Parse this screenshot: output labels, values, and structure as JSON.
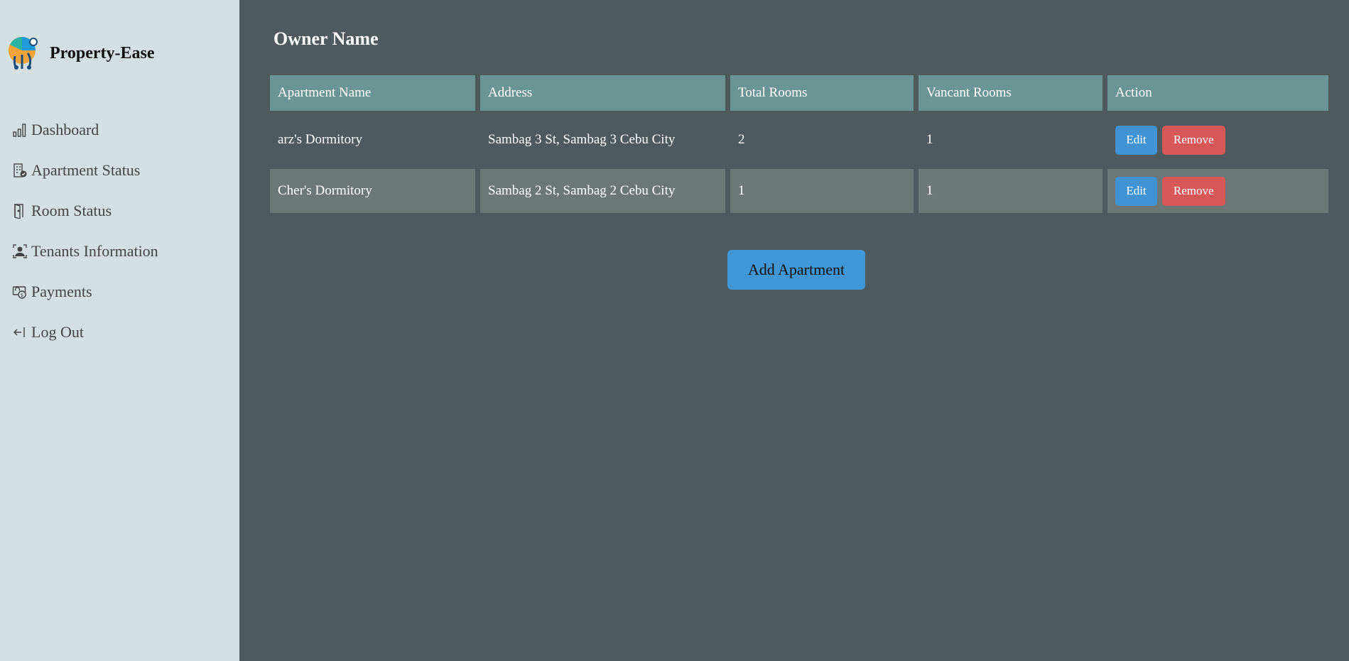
{
  "brand": {
    "name": "Property-Ease",
    "logo_icon": "property-ease-logo-icon"
  },
  "sidebar": {
    "items": [
      {
        "label": "Dashboard",
        "icon": "bar-chart-icon"
      },
      {
        "label": "Apartment Status",
        "icon": "building-check-icon"
      },
      {
        "label": "Room Status",
        "icon": "door-icon"
      },
      {
        "label": "Tenants Information",
        "icon": "person-badge-icon"
      },
      {
        "label": "Payments",
        "icon": "cash-icon"
      },
      {
        "label": "Log Out",
        "icon": "logout-arrow-icon"
      }
    ]
  },
  "main": {
    "owner_name": "Owner Name",
    "table": {
      "headers": [
        "Apartment Name",
        "Address",
        "Total Rooms",
        "Vancant Rooms",
        "Action"
      ],
      "rows": [
        {
          "name": "arz's Dormitory",
          "address": "Sambag 3 St, Sambag 3 Cebu City",
          "total": "2",
          "vacant": "1",
          "edit": "Edit",
          "remove": "Remove"
        },
        {
          "name": "Cher's Dormitory",
          "address": "Sambag 2 St, Sambag 2 Cebu City",
          "total": "1",
          "vacant": "1",
          "edit": "Edit",
          "remove": "Remove"
        }
      ]
    },
    "add_button": "Add Apartment"
  },
  "colors": {
    "sidebar_bg": "#d3dfe0",
    "main_bg": "#4e5a5d",
    "header_bg": "#6b9496",
    "edit": "#4193d3",
    "remove": "#d75858",
    "add": "#4196d5"
  }
}
